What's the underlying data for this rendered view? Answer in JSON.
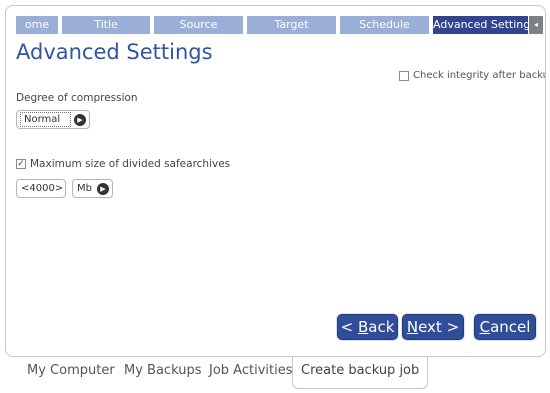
{
  "wizard": {
    "steps": [
      "ome",
      "Title",
      "Source",
      "Target",
      "Schedule",
      "Advanced Settings"
    ],
    "active_step": "Advanced Settings",
    "scroll_left_glyph": "◂"
  },
  "page": {
    "title": "Advanced Settings",
    "check_integrity_label": "Check integrity after backup",
    "check_integrity_checked": false,
    "compression_label": "Degree of compression",
    "compression_value": "Normal",
    "max_size_checkbox_label": "Maximum size of divided safearchives",
    "max_size_checked": true,
    "max_size_value": "4000",
    "stepper_dec": "<",
    "stepper_inc": ">",
    "unit_value": "Mb"
  },
  "buttons": {
    "back": "< Back",
    "next": "Next >",
    "cancel": "Cancel"
  },
  "bottom_tabs": [
    "My Computer",
    "My Backups",
    "Job Activities",
    "Create backup job"
  ],
  "active_bottom_tab": "Create backup job",
  "colors": {
    "step_inactive": "#9aafd8",
    "step_active": "#31448f",
    "title": "#2f55a4",
    "button": "#2f4d98"
  }
}
